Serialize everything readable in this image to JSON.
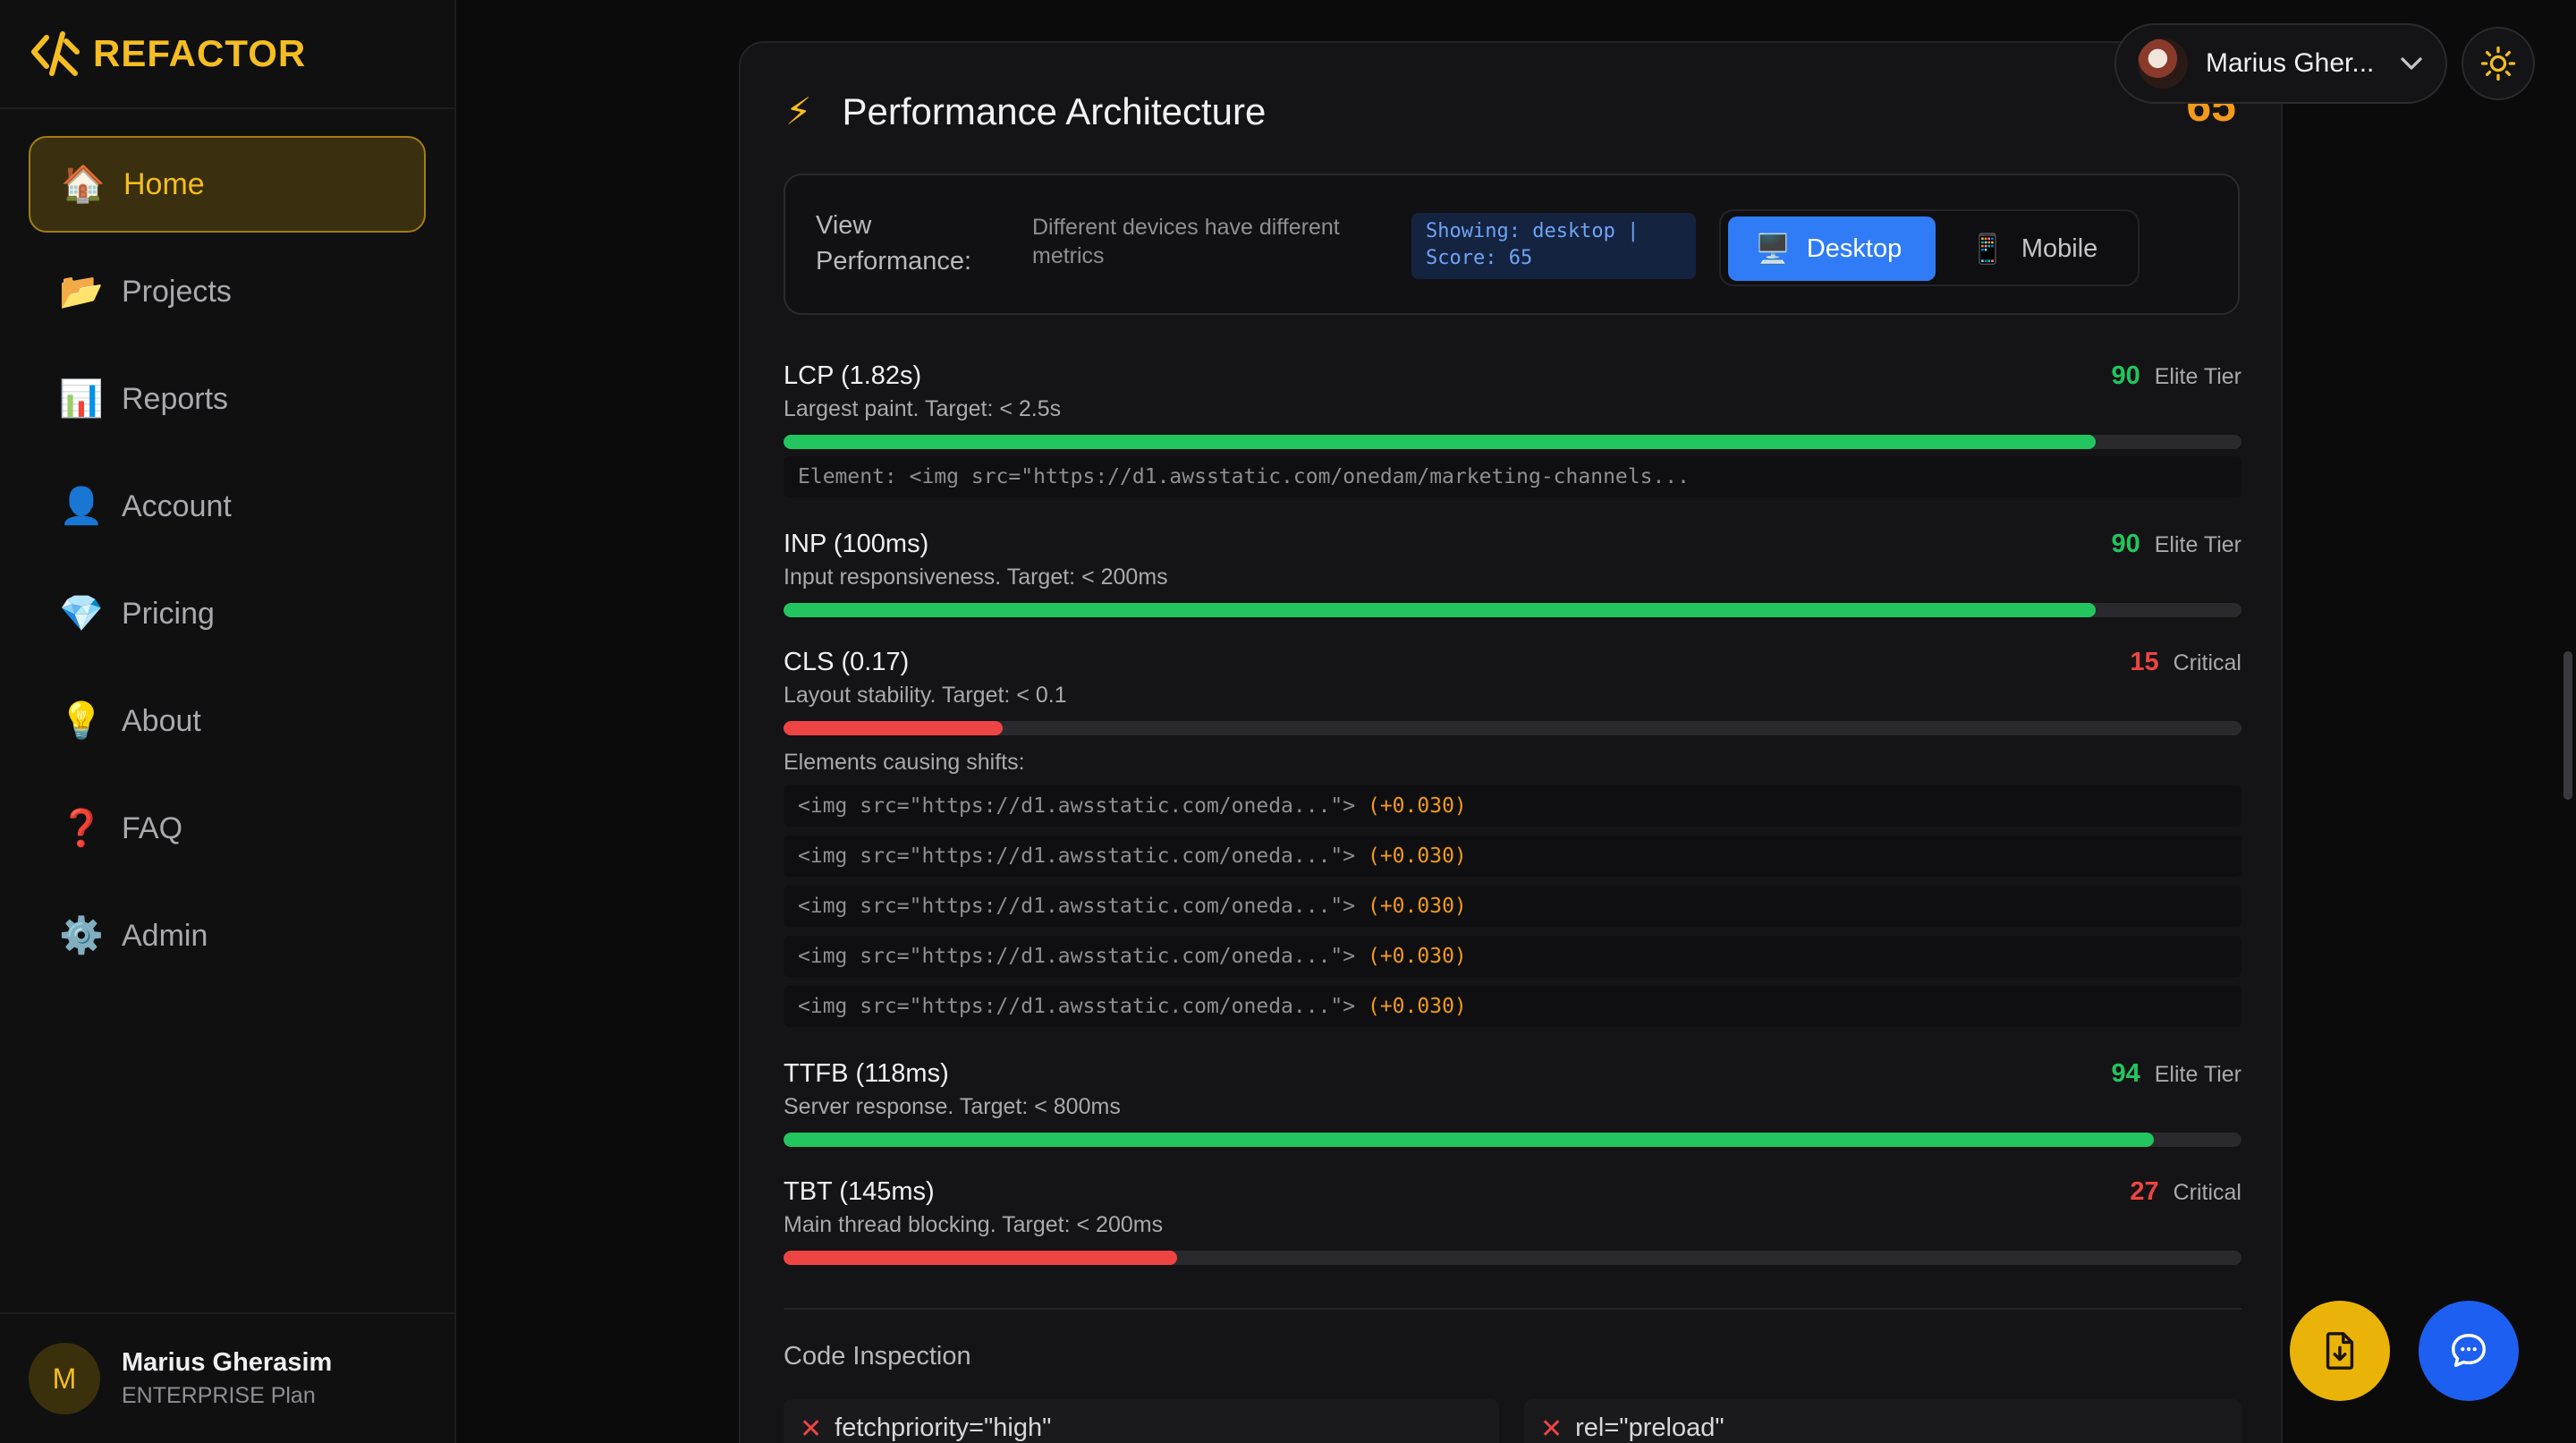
{
  "brand": {
    "name": "REFACTOR",
    "logo_icon": "refactor-logo-icon",
    "accent": "#f4bd22"
  },
  "sidebar": {
    "items": [
      {
        "label": "Home",
        "icon": "🏠",
        "active": true
      },
      {
        "label": "Projects",
        "icon": "📂"
      },
      {
        "label": "Reports",
        "icon": "📊"
      },
      {
        "label": "Account",
        "icon": "👤"
      },
      {
        "label": "Pricing",
        "icon": "💎"
      },
      {
        "label": "About",
        "icon": "💡"
      },
      {
        "label": "FAQ",
        "icon": "❓"
      },
      {
        "label": "Admin",
        "icon": "⚙️"
      }
    ],
    "user": {
      "initial": "M",
      "name": "Marius Gherasim",
      "plan": "ENTERPRISE Plan"
    }
  },
  "topbar": {
    "user_name": "Marius Gher...",
    "theme_icon": "sun-icon"
  },
  "card": {
    "icon": "⚡",
    "title": "Performance Architecture",
    "score": "65",
    "view": {
      "label": "View Performance:",
      "description": "Different devices have different metrics",
      "badge": "Showing: desktop | Score: 65",
      "desktop_label": "Desktop",
      "desktop_icon": "🖥️",
      "mobile_label": "Mobile",
      "mobile_icon": "📱"
    },
    "metrics": [
      {
        "title": "LCP (1.82s)",
        "subtitle": "Largest paint. Target: < 2.5s",
        "score": "90",
        "tier": "Elite Tier",
        "percent": 90,
        "status": "good"
      },
      {
        "title": "INP (100ms)",
        "subtitle": "Input responsiveness. Target: < 200ms",
        "score": "90",
        "tier": "Elite Tier",
        "percent": 90,
        "status": "good"
      },
      {
        "title": "CLS (0.17)",
        "subtitle": "Layout stability. Target: < 0.1",
        "score": "15",
        "tier": "Critical",
        "percent": 15,
        "status": "bad"
      },
      {
        "title": "TTFB (118ms)",
        "subtitle": "Server response. Target: < 800ms",
        "score": "94",
        "tier": "Elite Tier",
        "percent": 94,
        "status": "good"
      },
      {
        "title": "TBT (145ms)",
        "subtitle": "Main thread blocking. Target: < 200ms",
        "score": "27",
        "tier": "Critical",
        "percent": 27,
        "status": "bad"
      }
    ],
    "lcp_element": "Element: <img src=\"https://d1.awsstatic.com/onedam/marketing-channels...",
    "shifts_label": "Elements causing shifts:",
    "shifts": [
      {
        "code": "<img src=\"https://d1.awsstatic.com/oneda...\">",
        "delta": "(+0.030)"
      },
      {
        "code": "<img src=\"https://d1.awsstatic.com/oneda...\">",
        "delta": "(+0.030)"
      },
      {
        "code": "<img src=\"https://d1.awsstatic.com/oneda...\">",
        "delta": "(+0.030)"
      },
      {
        "code": "<img src=\"https://d1.awsstatic.com/oneda...\">",
        "delta": "(+0.030)"
      },
      {
        "code": "<img src=\"https://d1.awsstatic.com/oneda...\">",
        "delta": "(+0.030)"
      }
    ],
    "code_inspection": {
      "title": "Code Inspection",
      "checks": [
        {
          "label": "fetchpriority=\"high\"",
          "icon": "x-icon"
        },
        {
          "label": "rel=\"preload\"",
          "icon": "x-icon"
        }
      ]
    }
  },
  "fabs": {
    "download_icon": "download-file-icon",
    "chat_icon": "chat-icon"
  }
}
